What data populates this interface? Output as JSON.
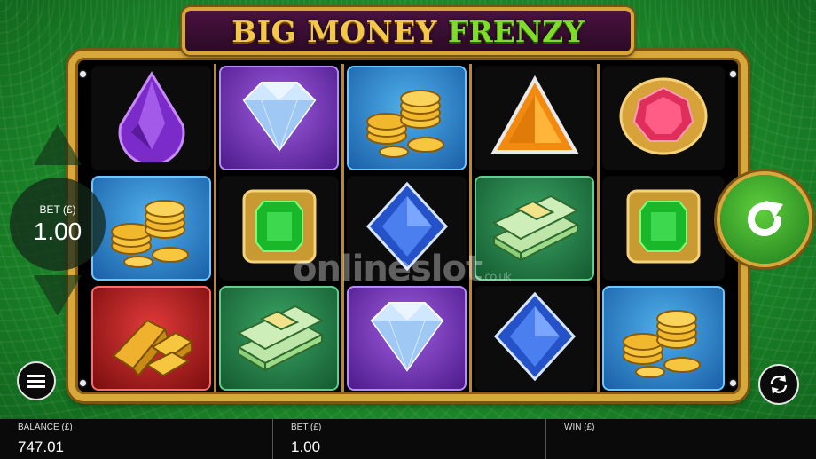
{
  "title": {
    "part1": "BIG MONEY",
    "part2": "FRENZY"
  },
  "reels": [
    [
      {
        "symbol": "purple-drop-gem",
        "bg": "dark"
      },
      {
        "symbol": "gold-coins",
        "bg": "blue"
      },
      {
        "symbol": "gold-bars",
        "bg": "red"
      }
    ],
    [
      {
        "symbol": "diamond",
        "bg": "purple"
      },
      {
        "symbol": "green-emerald",
        "bg": "dark"
      },
      {
        "symbol": "cash-stack",
        "bg": "green"
      }
    ],
    [
      {
        "symbol": "gold-coins",
        "bg": "blue"
      },
      {
        "symbol": "blue-sapphire",
        "bg": "dark"
      },
      {
        "symbol": "diamond",
        "bg": "purple"
      }
    ],
    [
      {
        "symbol": "orange-triangle-gem",
        "bg": "dark"
      },
      {
        "symbol": "cash-stack",
        "bg": "green"
      },
      {
        "symbol": "blue-sapphire",
        "bg": "dark"
      }
    ],
    [
      {
        "symbol": "red-ruby",
        "bg": "dark"
      },
      {
        "symbol": "green-emerald",
        "bg": "dark"
      },
      {
        "symbol": "gold-coins",
        "bg": "blue"
      }
    ]
  ],
  "watermark": {
    "main": "onlineslot",
    "suffix": ".co.uk"
  },
  "bet_control": {
    "label": "BET (£)",
    "value": "1.00"
  },
  "bottom_bar": {
    "balance_label": "BALANCE (£)",
    "balance_value": "747.01",
    "bet_label": "BET (£)",
    "bet_value": "1.00",
    "win_label": "WIN (£)",
    "win_value": ""
  },
  "icons": {
    "spin": "spin-arrow-icon",
    "menu": "menu-icon",
    "autoplay": "autoplay-icon",
    "bet_up": "triangle-up-icon",
    "bet_down": "triangle-down-icon"
  },
  "colors": {
    "frame_gold": "#d8a83c",
    "title_gold": "#f2c74a",
    "title_green": "#7fdc2a",
    "spin_green": "#3aa83a"
  }
}
